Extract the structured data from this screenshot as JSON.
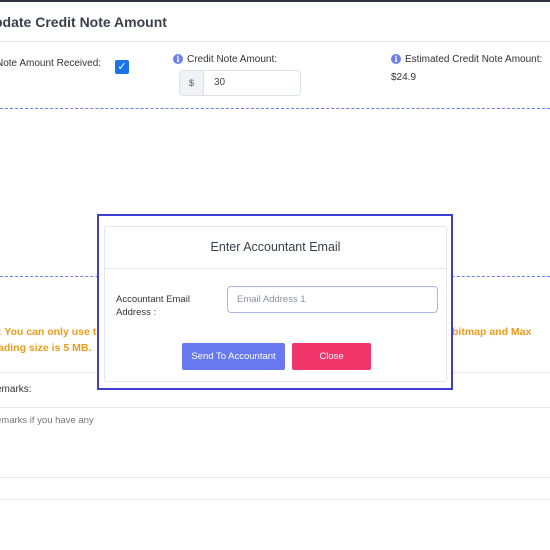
{
  "header": {
    "title": "pdate Credit Note Amount"
  },
  "form": {
    "received_label": "Note Amount Received:",
    "received_checked": true,
    "credit_amount_label": "Credit Note Amount:",
    "currency_prefix": "$",
    "credit_amount_value": "30",
    "estimated_label": "Estimated Credit Note Amount:",
    "estimated_value": "$24.9"
  },
  "notice": {
    "line1_left": ": You can only use tl",
    "line2_left": "ading size is 5 MB.",
    "line1_right": "bitmap and Max"
  },
  "remarks": {
    "label": "emarks:",
    "placeholder": "emarks if you have any"
  },
  "modal": {
    "title": "Enter Accountant Email",
    "field_label": "Accountant Email Address :",
    "email_placeholder": "Email Address 1",
    "send_label": "Send To Accountant",
    "close_label": "Close"
  },
  "colors": {
    "accent": "#6a7ef2",
    "modal_border": "#3d3ed6",
    "send_button": "#6878ee",
    "close_button": "#f1356b",
    "notice_text": "#f09a1c",
    "checkbox": "#1a73e8"
  },
  "icons": {
    "info": "info-icon",
    "check": "checkmark-icon"
  }
}
